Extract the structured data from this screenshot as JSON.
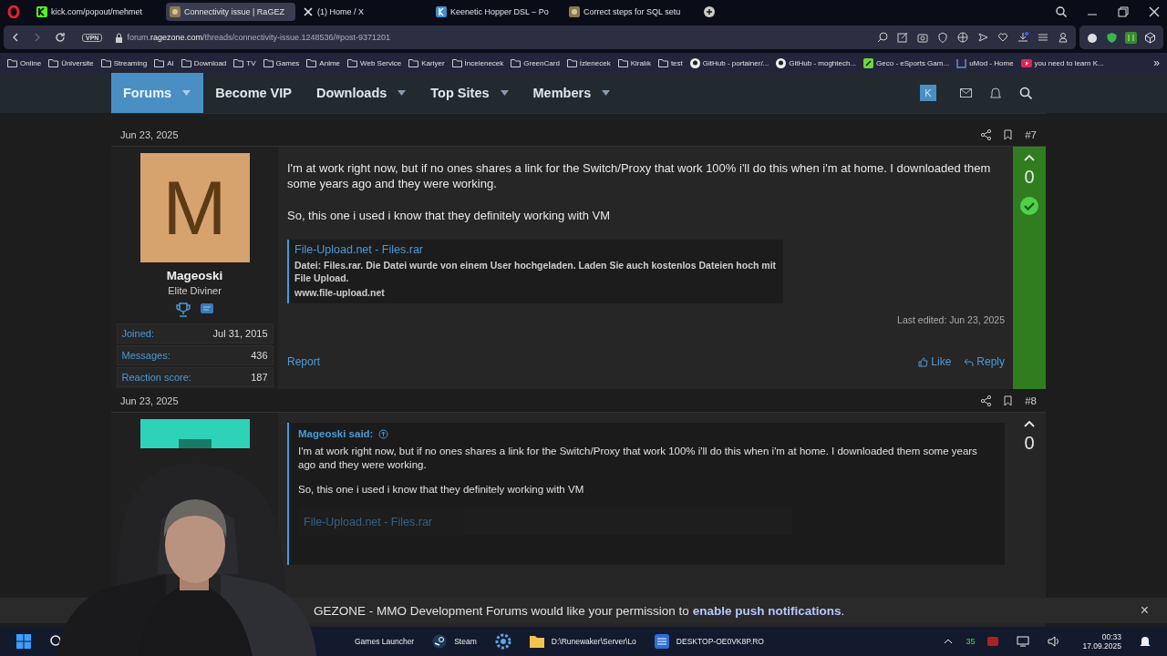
{
  "browser": {
    "tabs": [
      {
        "label": "kick.com/popout/mehmet",
        "kind": "kick",
        "selected": false
      },
      {
        "label": "Connectivity issue | RaGEZ",
        "kind": "site",
        "selected": true
      },
      {
        "label": "(1) Home / X",
        "kind": "x",
        "selected": false
      },
      {
        "label": "Keenetic Hopper DSL – Po",
        "kind": "keenetic",
        "selected": false
      },
      {
        "label": "Correct steps for SQL setu",
        "kind": "site",
        "selected": false
      }
    ],
    "address": {
      "vpn": "VPN",
      "domain_pre": "forum.",
      "domain": "ragezone.com",
      "path": "/threads/connectivity-issue.1248536/#post-9371201"
    },
    "bookmarks": [
      {
        "label": "Online",
        "kind": "folder"
      },
      {
        "label": "Üniversite",
        "kind": "folder"
      },
      {
        "label": "Streaming",
        "kind": "folder"
      },
      {
        "label": "AI",
        "kind": "folder"
      },
      {
        "label": "Download",
        "kind": "folder"
      },
      {
        "label": "TV",
        "kind": "folder"
      },
      {
        "label": "Games",
        "kind": "folder"
      },
      {
        "label": "Anime",
        "kind": "folder"
      },
      {
        "label": "Web Service",
        "kind": "folder"
      },
      {
        "label": "Kariyer",
        "kind": "folder"
      },
      {
        "label": "İncelenecek",
        "kind": "folder"
      },
      {
        "label": "GreenCard",
        "kind": "folder"
      },
      {
        "label": "İzlenecek",
        "kind": "folder"
      },
      {
        "label": "Kiralık",
        "kind": "folder"
      },
      {
        "label": "test",
        "kind": "folder"
      },
      {
        "label": "GitHub - portainer/...",
        "kind": "github"
      },
      {
        "label": "GitHub - moghtech...",
        "kind": "github"
      },
      {
        "label": "Geco - eSports Gam...",
        "kind": "geco"
      },
      {
        "label": "uMod - Home",
        "kind": "umod"
      },
      {
        "label": "you need to learn K...",
        "kind": "youtube"
      }
    ],
    "more": "»"
  },
  "nav": {
    "items": [
      {
        "label": "Forums",
        "caret": true,
        "selected": true
      },
      {
        "label": "Become VIP",
        "caret": false,
        "selected": false
      },
      {
        "label": "Downloads",
        "caret": true,
        "selected": false
      },
      {
        "label": "Top Sites",
        "caret": true,
        "selected": false
      },
      {
        "label": "Members",
        "caret": true,
        "selected": false
      }
    ],
    "avatar": "K"
  },
  "posts": [
    {
      "date": "Jun 23, 2025",
      "number": "#7",
      "avatar": "M",
      "user": "Mageoski",
      "user_title": "Elite Diviner",
      "stats": [
        {
          "label": "Joined:",
          "value": "Jul 31, 2015"
        },
        {
          "label": "Messages:",
          "value": "436"
        },
        {
          "label": "Reaction score:",
          "value": "187"
        }
      ],
      "paragraphs": [
        "I'm at work right now, but if no ones shares a link for the Switch/Proxy that work 100% i'll do this when i'm at home. I downloaded them some years ago and they were working.",
        "So, this one i used i know that they definitely working with VM"
      ],
      "link_card": {
        "title": "File-Upload.net - Files.rar",
        "description": "Datei: Files.rar. Die Datei wurde von einem User hochgeladen. Laden Sie auch kostenlos Dateien hoch mit File Upload.",
        "url": "www.file-upload.net"
      },
      "last_edited": "Last edited: Jun 23, 2025",
      "report": "Report",
      "like": "Like",
      "reply": "Reply",
      "score": "0",
      "solution": true
    },
    {
      "date": "Jun 23, 2025",
      "number": "#8",
      "quote": {
        "author": "Mageoski said:",
        "paragraphs": [
          "I'm at work right now, but if no ones shares a link for the Switch/Proxy that work 100% i'll do this when i'm at home. I downloaded them some years ago and they were working.",
          "So, this one i used i know that they definitely working with VM"
        ],
        "card_title": "File-Upload.net - Files.rar"
      },
      "score": "0",
      "solution": false
    }
  ],
  "push_bar": {
    "text": "GEZONE - MMO Development Forums would like your permission to **enable push notifications**.",
    "close": "×"
  },
  "taskbar": {
    "apps": [
      {
        "label": "Games Launcher",
        "kind": "plain"
      },
      {
        "label": "Steam",
        "kind": "steam"
      },
      {
        "kind": "gear"
      },
      {
        "label": "D:\\Runewaker\\Server\\Lo",
        "kind": "folder"
      },
      {
        "label": "DESKTOP-OE0VK8P.RO",
        "kind": "remote"
      }
    ],
    "tray_number": "35",
    "time": "00:33",
    "date": "17.09.2025"
  }
}
